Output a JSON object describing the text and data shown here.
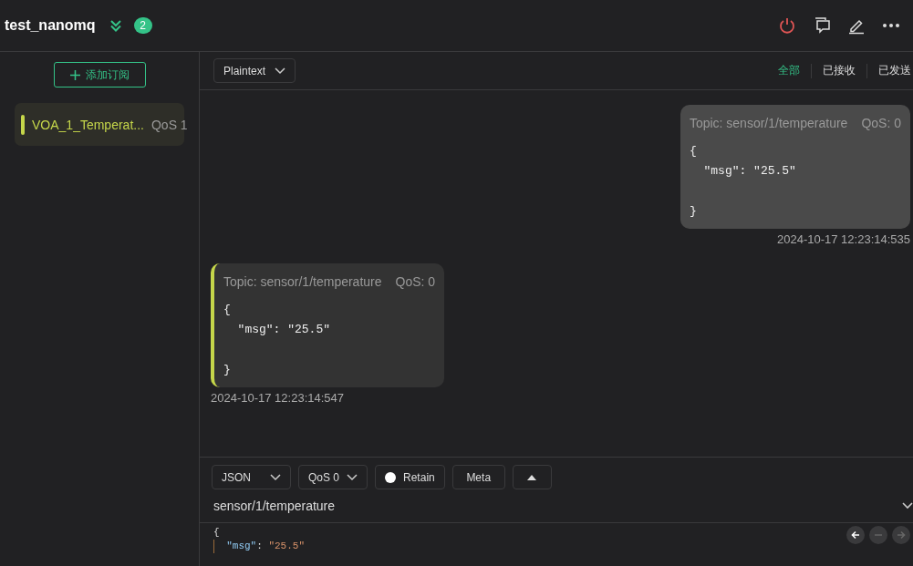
{
  "header": {
    "title": "test_nanomq",
    "badge": "2"
  },
  "sidebar": {
    "add_button": "添加订阅",
    "subscriptions": [
      {
        "topic": "VOA_1_Temperat...",
        "qos": "QoS 1",
        "color": "#c5d64a",
        "selected": true
      }
    ]
  },
  "toolbar": {
    "format": "Plaintext",
    "filters": [
      {
        "label": "全部",
        "selected": true
      },
      {
        "label": "已接收",
        "selected": false
      },
      {
        "label": "已发送",
        "selected": false
      }
    ]
  },
  "messages": [
    {
      "kind": "sent",
      "topic": "Topic: sensor/1/temperature",
      "qos": "QoS: 0",
      "payload": "{\n  \"msg\": \"25.5\"\n\n}",
      "time": "2024-10-17 12:23:14:535"
    },
    {
      "kind": "received",
      "color": "#c5d64a",
      "topic": "Topic: sensor/1/temperature",
      "qos": "QoS: 0",
      "payload": "{\n  \"msg\": \"25.5\"\n\n}",
      "time": "2024-10-17 12:23:14:547"
    }
  ],
  "composer": {
    "format": "JSON",
    "qos": "QoS 0",
    "retain": "Retain",
    "meta": "Meta",
    "topic": "sensor/1/temperature",
    "editor_lines": [
      [
        {
          "kind": "punct",
          "text": "{"
        }
      ],
      [
        {
          "kind": "key",
          "text": "  \"msg\""
        },
        {
          "kind": "punct",
          "text": ": "
        },
        {
          "kind": "string",
          "text": "\"25.5\""
        }
      ]
    ],
    "history": [
      {
        "kind": "back",
        "disabled": false
      },
      {
        "kind": "stop",
        "disabled": true
      },
      {
        "kind": "forward",
        "disabled": true
      }
    ]
  }
}
